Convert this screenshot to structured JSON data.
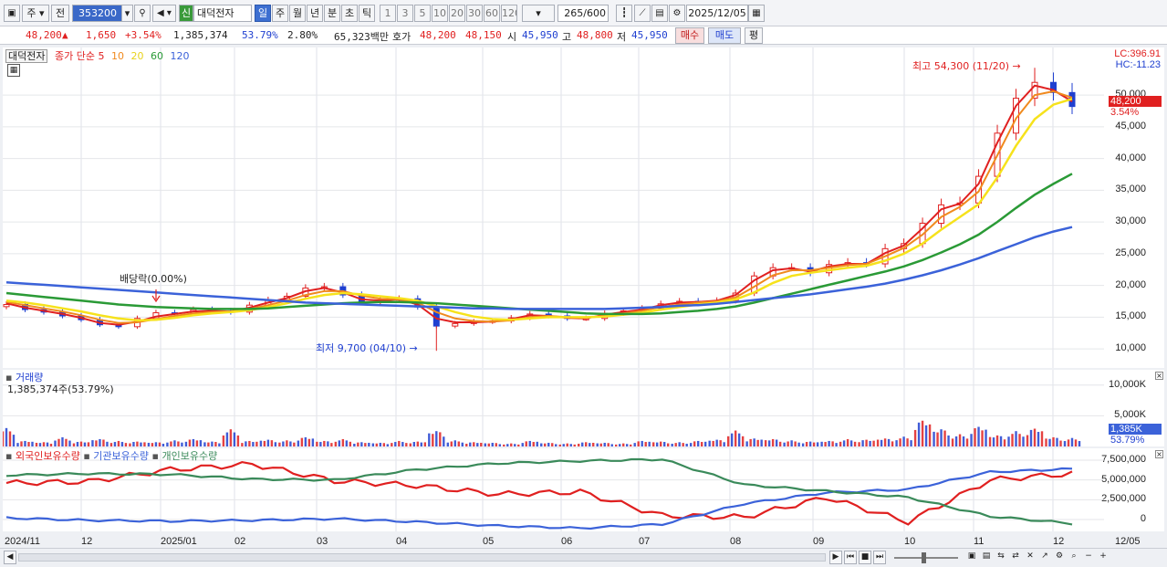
{
  "toolbar": {
    "market": "주",
    "mode": "전",
    "code": "353200",
    "new_badge": "신",
    "name": "대덕전자",
    "periods": [
      "일",
      "주",
      "월",
      "년",
      "분",
      "초",
      "틱"
    ],
    "ticks": [
      "1",
      "3",
      "5",
      "10",
      "20",
      "30",
      "60",
      "120"
    ],
    "count": "265",
    "total": "/600",
    "date": "2025/12/05"
  },
  "quote": {
    "price": "48,200",
    "arrow": "▲",
    "change": "1,650",
    "change_pct": "+3.54%",
    "volume": "1,385,374",
    "vol_ratio": "53.79%",
    "turnover": "2.80%",
    "amount": "65,323백만",
    "ask_label": "호가",
    "ask": "48,200",
    "bid": "48,150",
    "open_label": "시",
    "open": "45,950",
    "high_label": "고",
    "high": "48,800",
    "low_label": "저",
    "low": "45,950",
    "buy": "매수",
    "sell": "매도",
    "avg": "평"
  },
  "price_pane": {
    "title": "대덕전자",
    "legend_close": "종가 단순",
    "legend_ma": [
      "5",
      "10",
      "20",
      "60",
      "120"
    ],
    "lc": "LC:396.91",
    "hc": "HC:-11.23",
    "y_ticks": [
      "50,000",
      "45,000",
      "40,000",
      "35,000",
      "30,000",
      "25,000",
      "20,000",
      "15,000",
      "10,000"
    ],
    "last_label": "48,200",
    "last_pct": "3.54%",
    "high_note": "최고 54,300 (11/20)",
    "low_note": "최저 9,700 (04/10)",
    "dividend_note": "배당락(0.00%)"
  },
  "volume_pane": {
    "title": "거래량",
    "value": "1,385,374주(53.79%)",
    "y_ticks": [
      "10,000K",
      "5,000K"
    ],
    "last_label": "1,385K",
    "last_pct": "53.79%"
  },
  "holding_pane": {
    "legend": [
      "외국인보유수량",
      "기관보유수량",
      "개인보유수량"
    ],
    "y_ticks": [
      "7,500,000",
      "5,000,000",
      "2,500,000",
      "0"
    ]
  },
  "x_axis": [
    "2024/11",
    "12",
    "2025/01",
    "02",
    "03",
    "04",
    "05",
    "06",
    "07",
    "08",
    "09",
    "10",
    "11",
    "12",
    "12/05"
  ],
  "colors": {
    "up": "#e02020",
    "down": "#1f3fd0",
    "ma5": "#e02020",
    "ma10": "#f08a1e",
    "ma20": "#f6e21c",
    "ma60": "#2a9a36",
    "ma120": "#3b62d9",
    "foreign": "#e02020",
    "inst": "#3b62d9",
    "indiv": "#3a8a5a"
  },
  "chart_data": [
    {
      "type": "line",
      "title": "대덕전자",
      "ylim": [
        7000,
        57500
      ],
      "x": [
        "2024-11-01",
        "2024-11-08",
        "2024-11-15",
        "2024-11-22",
        "2024-11-29",
        "2024-12-06",
        "2024-12-13",
        "2024-12-20",
        "2024-12-27",
        "2025-01-03",
        "2025-01-10",
        "2025-01-17",
        "2025-01-24",
        "2025-01-31",
        "2025-02-07",
        "2025-02-14",
        "2025-02-21",
        "2025-02-28",
        "2025-03-07",
        "2025-03-14",
        "2025-03-21",
        "2025-03-28",
        "2025-04-04",
        "2025-04-11",
        "2025-04-18",
        "2025-04-25",
        "2025-05-02",
        "2025-05-09",
        "2025-05-16",
        "2025-05-23",
        "2025-05-30",
        "2025-06-06",
        "2025-06-13",
        "2025-06-20",
        "2025-06-27",
        "2025-07-04",
        "2025-07-11",
        "2025-07-18",
        "2025-07-25",
        "2025-08-01",
        "2025-08-08",
        "2025-08-15",
        "2025-08-22",
        "2025-08-29",
        "2025-09-05",
        "2025-09-12",
        "2025-09-19",
        "2025-09-26",
        "2025-10-03",
        "2025-10-10",
        "2025-10-17",
        "2025-10-24",
        "2025-10-31",
        "2025-11-07",
        "2025-11-14",
        "2025-11-21",
        "2025-11-28",
        "2025-12-05"
      ],
      "series": [
        {
          "name": "종가",
          "values": [
            17000,
            16200,
            15800,
            15200,
            14600,
            13800,
            13500,
            14800,
            15700,
            15600,
            16200,
            16000,
            15800,
            16900,
            17700,
            18300,
            19600,
            19800,
            18500,
            17300,
            17700,
            17900,
            16600,
            13600,
            14000,
            14300,
            14400,
            14900,
            15500,
            15200,
            14800,
            14800,
            15600,
            16000,
            16400,
            17100,
            17500,
            17400,
            17600,
            18800,
            21500,
            22800,
            22800,
            22000,
            23300,
            23600,
            23400,
            25800,
            26600,
            29800,
            32700,
            33000,
            37200,
            44000,
            49500,
            52000,
            50400,
            48200
          ]
        },
        {
          "name": "5",
          "values": [
            17200,
            16500,
            16000,
            15500,
            14900,
            14100,
            13800,
            14300,
            15100,
            15500,
            15900,
            16000,
            15900,
            16500,
            17300,
            18000,
            19100,
            19600,
            18900,
            17800,
            17600,
            17800,
            17000,
            14800,
            14200,
            14200,
            14300,
            14700,
            15300,
            15200,
            14900,
            14800,
            15400,
            15800,
            16200,
            16900,
            17300,
            17400,
            17600,
            18500,
            20800,
            22400,
            22700,
            22200,
            23000,
            23400,
            23400,
            25100,
            26300,
            29000,
            32000,
            32900,
            36000,
            42500,
            48300,
            51500,
            50800,
            49000
          ]
        },
        {
          "name": "10",
          "values": [
            17400,
            16900,
            16400,
            15900,
            15300,
            14600,
            14100,
            14200,
            14700,
            15200,
            15600,
            15800,
            15900,
            16300,
            16900,
            17600,
            18500,
            19100,
            19100,
            18400,
            17900,
            17800,
            17300,
            15800,
            14800,
            14400,
            14300,
            14500,
            15000,
            15200,
            15000,
            14900,
            15200,
            15600,
            16000,
            16600,
            17000,
            17300,
            17500,
            18100,
            19800,
            21600,
            22400,
            22400,
            22800,
            23200,
            23400,
            24600,
            25900,
            28000,
            30800,
            32400,
            34800,
            40500,
            46300,
            50000,
            50600,
            49600
          ]
        },
        {
          "name": "20",
          "values": [
            17600,
            17300,
            16900,
            16400,
            15900,
            15300,
            14800,
            14500,
            14600,
            14900,
            15300,
            15600,
            15800,
            16100,
            16600,
            17200,
            17900,
            18500,
            18800,
            18600,
            18300,
            18000,
            17600,
            16700,
            15800,
            15100,
            14700,
            14600,
            14800,
            15000,
            15000,
            15000,
            15100,
            15400,
            15700,
            16200,
            16600,
            17000,
            17300,
            17800,
            18900,
            20400,
            21500,
            22000,
            22400,
            22800,
            23100,
            23900,
            25000,
            26600,
            28800,
            30800,
            32800,
            37000,
            42000,
            46200,
            48500,
            49400
          ]
        },
        {
          "name": "60",
          "values": [
            18800,
            18500,
            18200,
            17900,
            17600,
            17300,
            17000,
            16800,
            16600,
            16500,
            16400,
            16300,
            16300,
            16300,
            16400,
            16600,
            16800,
            17000,
            17200,
            17300,
            17400,
            17400,
            17300,
            17200,
            17000,
            16800,
            16600,
            16400,
            16200,
            16000,
            15800,
            15600,
            15500,
            15500,
            15500,
            15600,
            15800,
            16000,
            16300,
            16700,
            17300,
            18000,
            18700,
            19400,
            20100,
            20800,
            21500,
            22200,
            23000,
            24000,
            25200,
            26500,
            28000,
            30000,
            32200,
            34300,
            36000,
            37600
          ]
        },
        {
          "name": "120",
          "values": [
            20500,
            20300,
            20100,
            19900,
            19700,
            19500,
            19300,
            19100,
            18900,
            18700,
            18500,
            18300,
            18100,
            17900,
            17700,
            17500,
            17300,
            17200,
            17100,
            17000,
            16900,
            16800,
            16700,
            16600,
            16500,
            16400,
            16400,
            16300,
            16300,
            16300,
            16300,
            16300,
            16300,
            16400,
            16500,
            16600,
            16800,
            16900,
            17100,
            17400,
            17700,
            18000,
            18300,
            18600,
            19000,
            19400,
            19800,
            20300,
            20900,
            21600,
            22400,
            23300,
            24300,
            25400,
            26500,
            27600,
            28500,
            29200
          ]
        }
      ]
    },
    {
      "type": "bar",
      "title": "거래량",
      "ylim": [
        0,
        12500000
      ],
      "x": [
        "2024-11-01",
        "2024-11-08",
        "2024-11-15",
        "2024-11-22",
        "2024-11-29",
        "2024-12-06",
        "2024-12-13",
        "2024-12-20",
        "2024-12-27",
        "2025-01-03",
        "2025-01-10",
        "2025-01-17",
        "2025-01-24",
        "2025-01-31",
        "2025-02-07",
        "2025-02-14",
        "2025-02-21",
        "2025-02-28",
        "2025-03-07",
        "2025-03-14",
        "2025-03-21",
        "2025-03-28",
        "2025-04-04",
        "2025-04-11",
        "2025-04-18",
        "2025-04-25",
        "2025-05-02",
        "2025-05-09",
        "2025-05-16",
        "2025-05-23",
        "2025-05-30",
        "2025-06-06",
        "2025-06-13",
        "2025-06-20",
        "2025-06-27",
        "2025-07-04",
        "2025-07-11",
        "2025-07-18",
        "2025-07-25",
        "2025-08-01",
        "2025-08-08",
        "2025-08-15",
        "2025-08-22",
        "2025-08-29",
        "2025-09-05",
        "2025-09-12",
        "2025-09-19",
        "2025-09-26",
        "2025-10-03",
        "2025-10-10",
        "2025-10-17",
        "2025-10-24",
        "2025-10-31",
        "2025-11-07",
        "2025-11-14",
        "2025-11-21",
        "2025-11-28",
        "2025-12-05"
      ],
      "series": [
        {
          "name": "거래량",
          "values": [
            3000000,
            900000,
            700000,
            1500000,
            800000,
            1200000,
            900000,
            800000,
            700000,
            1000000,
            1200000,
            800000,
            2800000,
            900000,
            1100000,
            1000000,
            1500000,
            900000,
            1200000,
            700000,
            600000,
            900000,
            800000,
            2500000,
            1000000,
            700000,
            600000,
            500000,
            900000,
            600000,
            500000,
            700000,
            600000,
            500000,
            900000,
            800000,
            700000,
            900000,
            1100000,
            2600000,
            1300000,
            1200000,
            1000000,
            800000,
            900000,
            1200000,
            1100000,
            1300000,
            1600000,
            4200000,
            2800000,
            2000000,
            3200000,
            1800000,
            2500000,
            2900000,
            1500000,
            1385374
          ]
        }
      ]
    },
    {
      "type": "line",
      "title": "",
      "ylim": [
        -1500000,
        9000000
      ],
      "x": [
        "2024-11",
        "2024-12",
        "2025-01",
        "2025-02",
        "2025-03",
        "2025-04",
        "2025-05",
        "2025-06",
        "2025-07",
        "2025-08",
        "2025-09",
        "2025-10",
        "2025-11",
        "2025-12"
      ],
      "series": [
        {
          "name": "외국인보유수량",
          "values": [
            4600000,
            4800000,
            6300000,
            7000000,
            4900000,
            4300000,
            3200000,
            3500000,
            500000,
            300000,
            2800000,
            -300000,
            5000000,
            5800000
          ]
        },
        {
          "name": "기관보유수량",
          "values": [
            200000,
            -100000,
            -200000,
            -100000,
            100000,
            -300000,
            -800000,
            -1100000,
            -600000,
            2000000,
            3400000,
            3800000,
            6000000,
            6400000
          ]
        },
        {
          "name": "개인보유수량",
          "values": [
            5600000,
            5800000,
            5700000,
            5100000,
            5000000,
            6300000,
            7100000,
            7400000,
            7600000,
            4400000,
            3600000,
            2800000,
            400000,
            -500000
          ]
        }
      ]
    }
  ]
}
